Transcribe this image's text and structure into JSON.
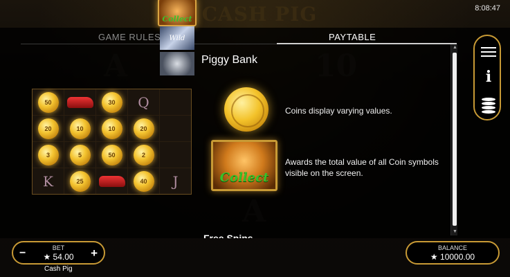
{
  "game": {
    "title": "Cash Pig",
    "clock": "8:08:47"
  },
  "tabs": {
    "rules": "GAME RULES",
    "paytable": "PAYTABLE",
    "active": "PAYTABLE"
  },
  "paytable": {
    "section_title": "Piggy Bank",
    "next_section_title": "Free Spins",
    "coin_description": "Coins display varying values.",
    "collect_description": "Awards the total value of all Coin symbols visible on the screen.",
    "collect_label": "Collect",
    "wild_label": "Wild",
    "grid": {
      "rows": [
        [
          {
            "type": "coin",
            "value": "50"
          },
          {
            "type": "car"
          },
          {
            "type": "coin",
            "value": "30"
          },
          {
            "type": "letter",
            "value": "Q"
          },
          {
            "type": "empty"
          }
        ],
        [
          {
            "type": "coin",
            "value": "20"
          },
          {
            "type": "coin",
            "value": "10"
          },
          {
            "type": "coin",
            "value": "10"
          },
          {
            "type": "coin",
            "value": "20"
          },
          {
            "type": "empty"
          }
        ],
        [
          {
            "type": "coin",
            "value": "3"
          },
          {
            "type": "coin",
            "value": "5"
          },
          {
            "type": "coin",
            "value": "50"
          },
          {
            "type": "coin",
            "value": "2"
          },
          {
            "type": "empty"
          }
        ],
        [
          {
            "type": "letter",
            "value": "K"
          },
          {
            "type": "coin",
            "value": "25"
          },
          {
            "type": "car"
          },
          {
            "type": "coin",
            "value": "40"
          },
          {
            "type": "letter",
            "value": "J"
          }
        ]
      ]
    }
  },
  "side_buttons": {
    "menu_icon": "menu-icon",
    "info_icon": "info-icon",
    "info_glyph": "i",
    "coins_icon": "coins-stack-icon"
  },
  "bet": {
    "label": "BET",
    "value": "★ 54.00",
    "minus": "−",
    "plus": "+"
  },
  "game_name": "Cash Pig",
  "balance": {
    "label": "BALANCE",
    "value": "★ 10000.00"
  },
  "colors": {
    "accent_gold": "#c89a35",
    "collect_green": "#39c12a"
  }
}
